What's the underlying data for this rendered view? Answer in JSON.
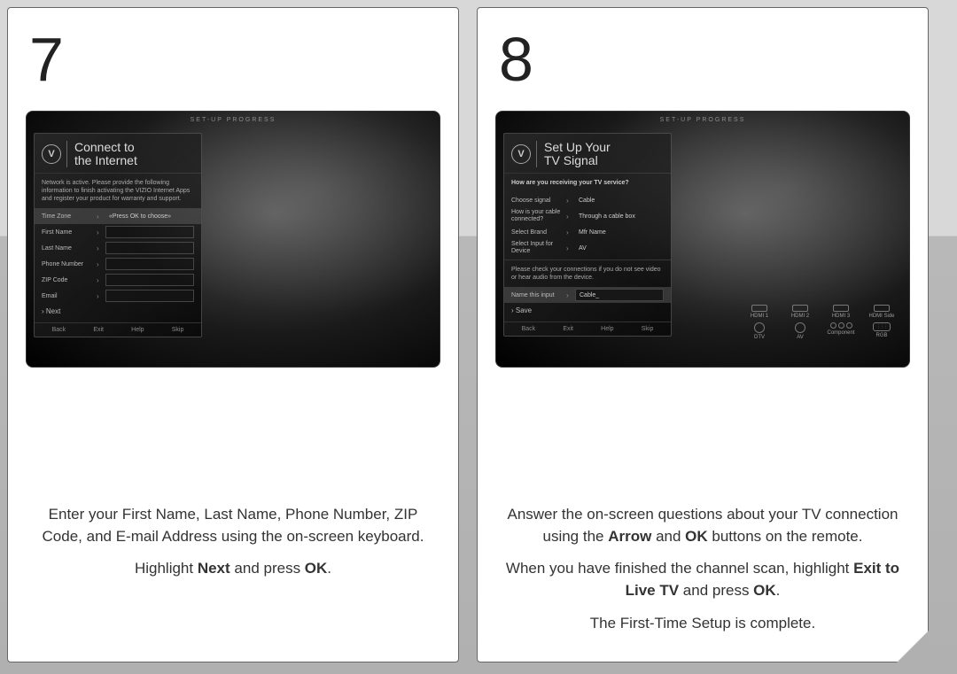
{
  "steps": {
    "left": {
      "number": "7"
    },
    "right": {
      "number": "8"
    }
  },
  "tv_header": "SET-UP PROGRESS",
  "left_panel": {
    "logo_letter": "V",
    "title_line1": "Connect to",
    "title_line2": "the Internet",
    "desc": "Network is active. Please provide the following information to finish activating the VIZIO Internet Apps and register your product for warranty and support.",
    "rows": [
      {
        "label": "Time Zone",
        "value": "«Press OK to choose»",
        "active": true,
        "boxed": false
      },
      {
        "label": "First Name",
        "value": "",
        "active": false,
        "boxed": true
      },
      {
        "label": "Last Name",
        "value": "",
        "active": false,
        "boxed": true
      },
      {
        "label": "Phone Number",
        "value": "",
        "active": false,
        "boxed": true
      },
      {
        "label": "ZIP Code",
        "value": "",
        "active": false,
        "boxed": true
      },
      {
        "label": "Email",
        "value": "",
        "active": false,
        "boxed": true
      }
    ],
    "next": "Next",
    "footer": [
      "Back",
      "Exit",
      "Help",
      "Skip"
    ]
  },
  "right_panel": {
    "logo_letter": "V",
    "title_line1": "Set Up Your",
    "title_line2": "TV Signal",
    "q1": "How are you receiving your TV service?",
    "rows": [
      {
        "label": "Choose signal",
        "value": "Cable"
      },
      {
        "label": "How is your cable connected?",
        "value": "Through a cable box"
      },
      {
        "label": "Select Brand",
        "value": "Mfr Name"
      },
      {
        "label": "Select Input for Device",
        "value": "AV"
      }
    ],
    "check_msg": "Please check your connections if you do not see video or hear audio from the device.",
    "name_input_label": "Name this input",
    "name_input_value": "Cable_",
    "save": "Save",
    "footer": [
      "Back",
      "Exit",
      "Help",
      "Skip"
    ]
  },
  "ports": {
    "row1": [
      "HDMI 1",
      "HDMI 2",
      "HDMI 3",
      "HDMI Side"
    ],
    "row2": [
      "DTV",
      "AV",
      "Component",
      "RGB"
    ]
  },
  "instructions": {
    "left": {
      "p1": "Enter your First Name, Last Name, Phone Number, ZIP Code, and E-mail Address using the on-screen keyboard.",
      "p2_a": "Highlight ",
      "p2_b": "Next",
      "p2_c": " and press ",
      "p2_d": "OK",
      "p2_e": "."
    },
    "right": {
      "p1_a": "Answer the on-screen questions about your TV connection using the ",
      "p1_b": "Arrow",
      "p1_c": " and ",
      "p1_d": "OK",
      "p1_e": " buttons on the remote.",
      "p2_a": "When you have finished the channel scan, highlight ",
      "p2_b": "Exit to Live TV",
      "p2_c": " and press ",
      "p2_d": "OK",
      "p2_e": ".",
      "p3": "The First-Time Setup is complete."
    }
  }
}
